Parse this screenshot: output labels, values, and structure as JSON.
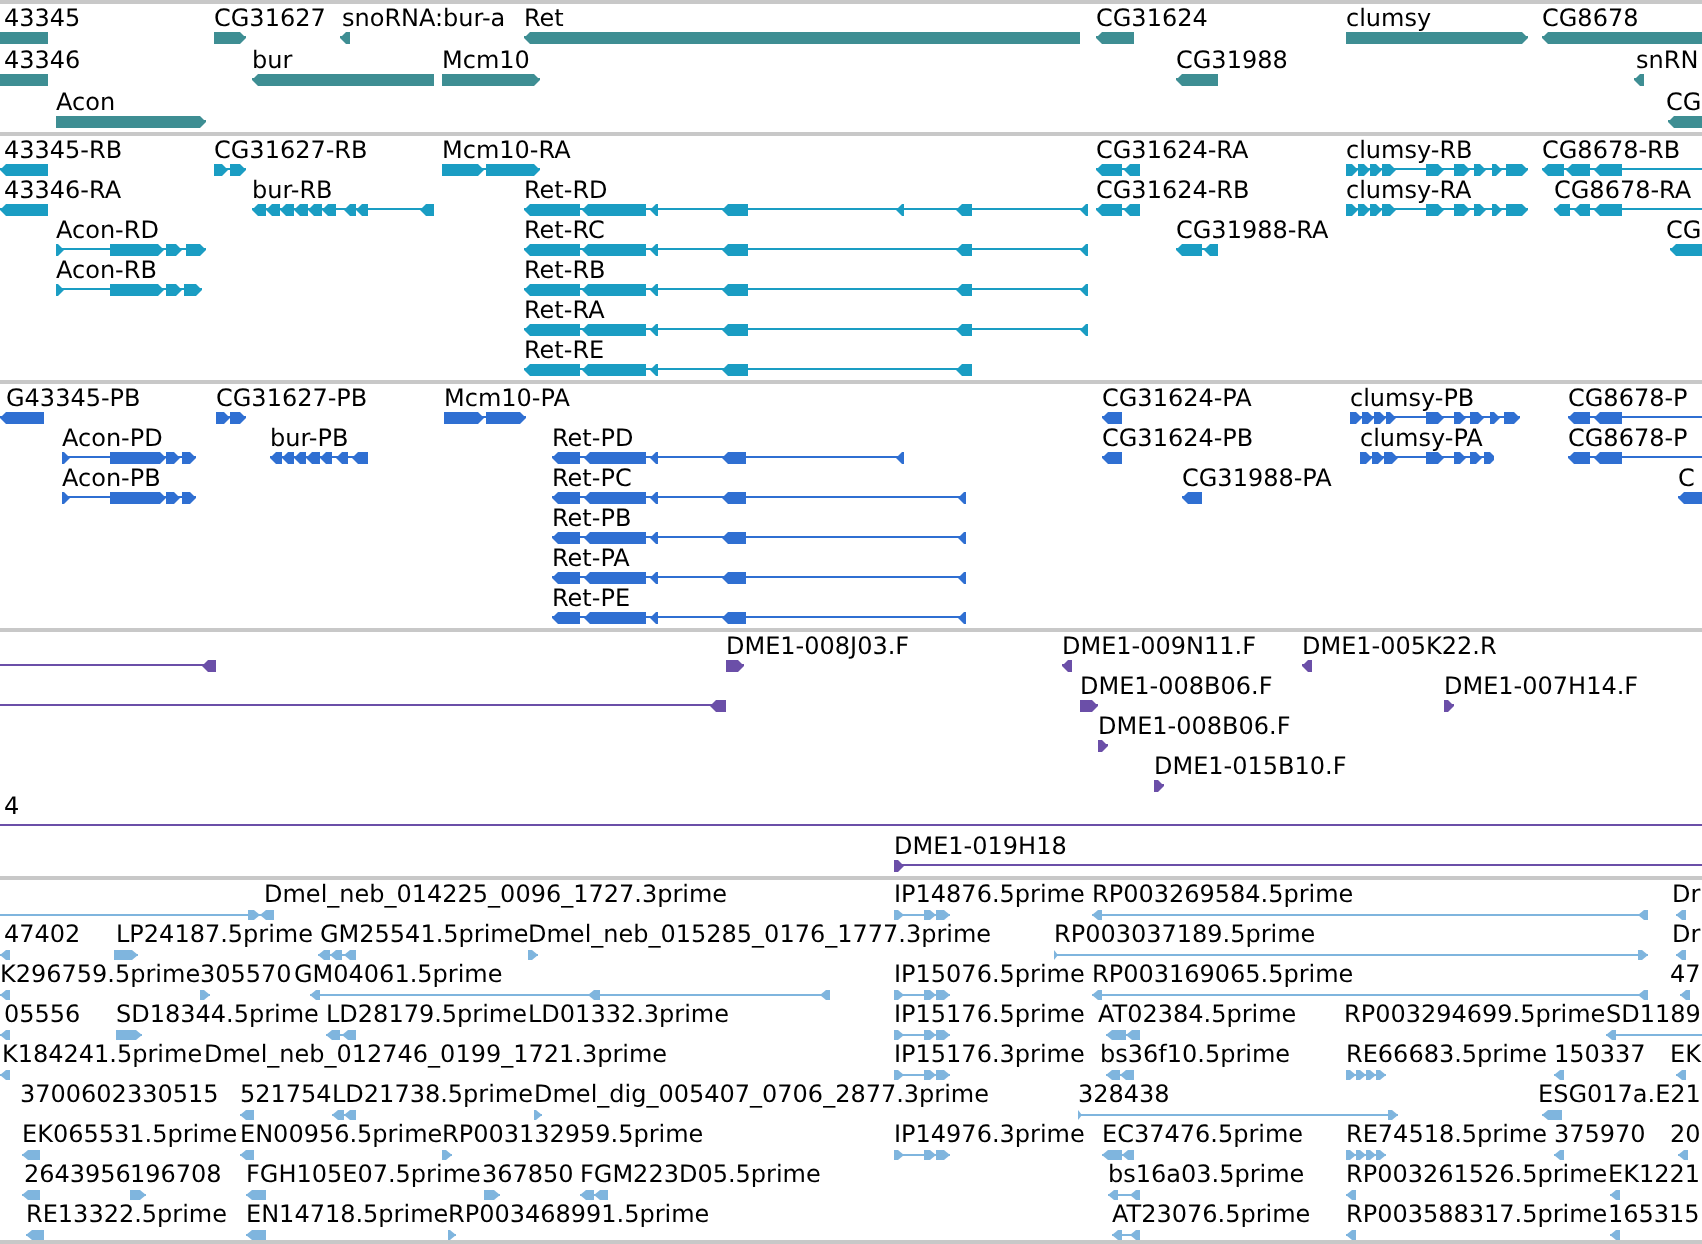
{
  "tracks": [
    {
      "kind": "gene",
      "color": "#3e8e93",
      "features": [
        {
          "label": "43345",
          "reverse": true
        },
        {
          "label": "CG31627",
          "reverse": false
        },
        {
          "label": "snoRNA:bur-a",
          "reverse": true
        },
        {
          "label": "Ret",
          "reverse": true
        },
        {
          "label": "CG31624",
          "reverse": true
        },
        {
          "label": "clumsy",
          "reverse": false
        },
        {
          "label": "CG8678",
          "reverse": true
        },
        {
          "label": "43346",
          "reverse": true
        },
        {
          "label": "bur",
          "reverse": true
        },
        {
          "label": "Mcm10",
          "reverse": false
        },
        {
          "label": "CG31988",
          "reverse": true
        },
        {
          "label": "snRN",
          "reverse": true
        },
        {
          "label": "Acon",
          "reverse": false
        },
        {
          "label": "CG",
          "reverse": true
        }
      ]
    },
    {
      "kind": "transcript",
      "color": "#1a9dc3",
      "features": [
        {
          "label": "43345-RB",
          "reverse": true
        },
        {
          "label": "CG31627-RB",
          "reverse": false
        },
        {
          "label": "Mcm10-RA",
          "reverse": false
        },
        {
          "label": "CG31624-RA",
          "reverse": true
        },
        {
          "label": "clumsy-RB",
          "reverse": false
        },
        {
          "label": "CG8678-RB",
          "reverse": true
        },
        {
          "label": "43346-RA",
          "reverse": true
        },
        {
          "label": "bur-RB",
          "reverse": true
        },
        {
          "label": "Ret-RD",
          "reverse": true
        },
        {
          "label": "CG31624-RB",
          "reverse": true
        },
        {
          "label": "clumsy-RA",
          "reverse": false
        },
        {
          "label": "CG8678-RA",
          "reverse": true
        },
        {
          "label": "Acon-RD",
          "reverse": false
        },
        {
          "label": "Ret-RC",
          "reverse": true
        },
        {
          "label": "CG31988-RA",
          "reverse": true
        },
        {
          "label": "CG",
          "reverse": true
        },
        {
          "label": "Acon-RB",
          "reverse": false
        },
        {
          "label": "Ret-RB",
          "reverse": true
        },
        {
          "label": "Ret-RA",
          "reverse": true
        },
        {
          "label": "Ret-RE",
          "reverse": true
        }
      ]
    },
    {
      "kind": "protein",
      "color": "#2f6fd2",
      "features": [
        {
          "label": "G43345-PB",
          "reverse": true
        },
        {
          "label": "CG31627-PB",
          "reverse": false
        },
        {
          "label": "Mcm10-PA",
          "reverse": false
        },
        {
          "label": "CG31624-PA",
          "reverse": true
        },
        {
          "label": "clumsy-PB",
          "reverse": false
        },
        {
          "label": "CG8678-P",
          "reverse": true
        },
        {
          "label": "Acon-PD",
          "reverse": false
        },
        {
          "label": "bur-PB",
          "reverse": true
        },
        {
          "label": "Ret-PD",
          "reverse": true
        },
        {
          "label": "CG31624-PB",
          "reverse": true
        },
        {
          "label": "clumsy-PA",
          "reverse": false
        },
        {
          "label": "CG8678-P",
          "reverse": true
        },
        {
          "label": "Acon-PB",
          "reverse": false
        },
        {
          "label": "Ret-PC",
          "reverse": true
        },
        {
          "label": "CG31988-PA",
          "reverse": true
        },
        {
          "label": "C",
          "reverse": true
        },
        {
          "label": "Ret-PB",
          "reverse": true
        },
        {
          "label": "Ret-PA",
          "reverse": true
        },
        {
          "label": "Ret-PE",
          "reverse": true
        }
      ]
    },
    {
      "kind": "clone",
      "color": "#6b4fa8",
      "features": [
        {
          "reverse": true
        },
        {
          "label": "DME1-008J03.F",
          "reverse": false
        },
        {
          "label": "DME1-009N11.F",
          "reverse": true
        },
        {
          "label": "DME1-005K22.R",
          "reverse": true
        },
        {
          "reverse": true
        },
        {
          "label": "DME1-008B06.F",
          "reverse": false
        },
        {
          "label": "DME1-007H14.F",
          "reverse": false
        },
        {
          "label": "DME1-008B06.F",
          "reverse": false
        },
        {
          "label": "DME1-015B10.F",
          "reverse": false
        },
        {
          "label": "4"
        },
        {
          "label": "DME1-019H18",
          "reverse": false
        }
      ]
    },
    {
      "kind": "est",
      "color": "#7fb5de",
      "features": [
        {
          "reverse": false
        },
        {
          "label": "Dmel_neb_014225_0096_1727.3prime",
          "reverse": true
        },
        {
          "label": "IP14876.5prime",
          "reverse": false
        },
        {
          "label": "RP003269584.5prime",
          "reverse": true
        },
        {
          "label": "Dr",
          "reverse": true
        },
        {
          "label": "47402",
          "reverse": true
        },
        {
          "label": "LP24187.5prime",
          "reverse": false
        },
        {
          "label": "GM25541.5prime",
          "reverse": true
        },
        {
          "label": "Dmel_neb_015285_0176_1777.3prime",
          "reverse": false
        },
        {
          "label": "RP003037189.5prime",
          "reverse": false
        },
        {
          "label": "Dr",
          "reverse": true
        },
        {
          "label": "K296759.5prime",
          "reverse": true
        },
        {
          "label": "305570",
          "reverse": false
        },
        {
          "label": "GM04061.5prime",
          "reverse": true
        },
        {
          "label": "IP15076.5prime",
          "reverse": false
        },
        {
          "label": "RP003169065.5prime",
          "reverse": true
        },
        {
          "label": "47",
          "reverse": true
        },
        {
          "label": "05556",
          "reverse": true
        },
        {
          "label": "SD18344.5prime",
          "reverse": false
        },
        {
          "label": "LD28179.5prime",
          "reverse": true
        },
        {
          "label": "LD01332.3prime"
        },
        {
          "label": "IP15176.5prime",
          "reverse": false
        },
        {
          "label": "AT02384.5prime",
          "reverse": true
        },
        {
          "label": "RP003294699.5prime"
        },
        {
          "label": "SD1189",
          "reverse": true
        },
        {
          "label": "K184241.5prime",
          "reverse": true
        },
        {
          "label": "Dmel_neb_012746_0199_1721.3prime"
        },
        {
          "label": "IP15176.3prime",
          "reverse": false
        },
        {
          "label": "bs36f10.5prime",
          "reverse": true
        },
        {
          "label": "RE66683.5prime",
          "reverse": false
        },
        {
          "label": "150337",
          "reverse": true
        },
        {
          "label": "EK",
          "reverse": true
        },
        {
          "label": "3700602330515"
        },
        {
          "label": "521754",
          "reverse": true
        },
        {
          "label": "LD21738.5prime",
          "reverse": true
        },
        {
          "label": "Dmel_dig_005407_0706_2877.3prime",
          "reverse": false
        },
        {
          "label": "328438",
          "reverse": false
        },
        {
          "label": "ESG017a.E21",
          "reverse": true
        },
        {
          "label": "EK065531.5prime",
          "reverse": true
        },
        {
          "label": "EN00956.5prime",
          "reverse": true
        },
        {
          "label": "RP003132959.5prime",
          "reverse": false
        },
        {
          "label": "IP14976.3prime",
          "reverse": false
        },
        {
          "label": "EC37476.5prime",
          "reverse": true
        },
        {
          "label": "RE74518.5prime",
          "reverse": false
        },
        {
          "label": "375970",
          "reverse": true
        },
        {
          "label": "20",
          "reverse": true
        },
        {
          "label": "2643956",
          "reverse": true
        },
        {
          "label": "196708",
          "reverse": false
        },
        {
          "label": "FGH105E07.5prime",
          "reverse": true
        },
        {
          "label": "367850",
          "reverse": false
        },
        {
          "label": "FGM223D05.5prime",
          "reverse": true
        },
        {
          "label": "bs16a03.5prime",
          "reverse": true
        },
        {
          "label": "RP003261526.5prime",
          "reverse": true
        },
        {
          "label": "EK1221",
          "reverse": true
        },
        {
          "label": "RE13322.5prime",
          "reverse": true
        },
        {
          "label": "EN14718.5prime",
          "reverse": true
        },
        {
          "label": "RP003468991.5prime",
          "reverse": false
        },
        {
          "label": "AT23076.5prime",
          "reverse": true
        },
        {
          "label": "RP003588317.5prime",
          "reverse": true
        },
        {
          "label": "165315",
          "reverse": true
        }
      ]
    }
  ]
}
